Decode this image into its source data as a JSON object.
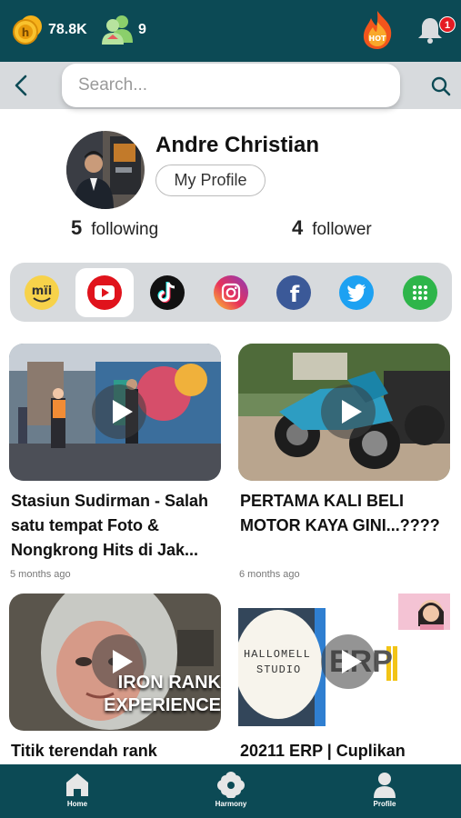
{
  "header": {
    "coins": "78.8K",
    "friends": "9",
    "hot_label": "HOT",
    "notification_count": "1"
  },
  "search": {
    "placeholder": "Search..."
  },
  "profile": {
    "name": "Andre Christian",
    "button_label": "My Profile",
    "following_count": "5",
    "following_label": "following",
    "follower_count": "4",
    "follower_label": "follower"
  },
  "social_platforms": [
    {
      "name": "mii",
      "label": "mïi"
    },
    {
      "name": "youtube",
      "selected": true
    },
    {
      "name": "tiktok"
    },
    {
      "name": "instagram"
    },
    {
      "name": "facebook",
      "label": "f"
    },
    {
      "name": "twitter"
    },
    {
      "name": "more-apps"
    }
  ],
  "videos": [
    {
      "title": "Stasiun Sudirman - Salah satu tempat Foto & Nongkrong Hits di Jak...",
      "time": "5 months ago"
    },
    {
      "title": "PERTAMA KALI BELI MOTOR KAYA GINI...????",
      "time": "6 months ago"
    },
    {
      "title": "Titik terendah rank",
      "overlay": "IRON RANK\nEXPERIENCE"
    },
    {
      "title": "20211 ERP | Cuplikan",
      "overlay_a": "HALLOMELL",
      "overlay_b": "STUDIO",
      "overlay_c": "ERP"
    }
  ],
  "bottom_nav": [
    {
      "label": "Home"
    },
    {
      "label": "Harmony"
    },
    {
      "label": "Profile"
    }
  ],
  "colors": {
    "brand": "#0c4a55",
    "badge": "#e51b23",
    "panel": "#d7dadd"
  }
}
